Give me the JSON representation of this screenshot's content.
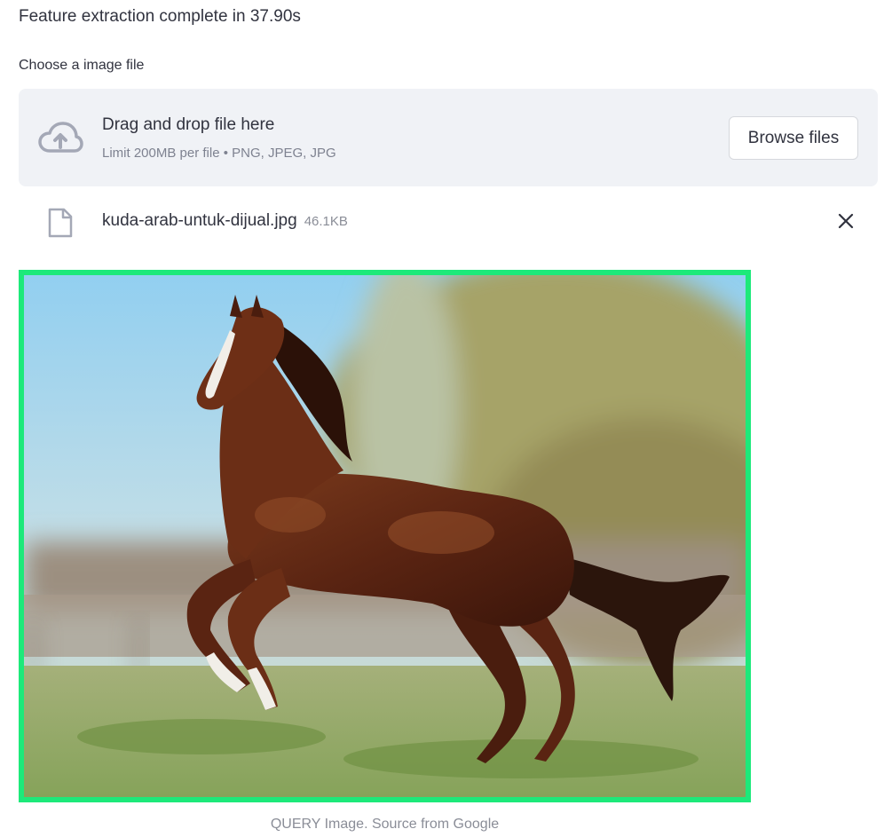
{
  "status": {
    "message": "Feature extraction complete in 37.90s"
  },
  "uploader": {
    "label": "Choose a image file",
    "dropzone_title": "Drag and drop file here",
    "dropzone_limit": "Limit 200MB per file • PNG, JPEG, JPG",
    "browse_label": "Browse files",
    "icon": "cloud-upload-icon"
  },
  "uploaded_file": {
    "name": "kuda-arab-untuk-dijual.jpg",
    "size": "46.1KB",
    "icon": "file-icon",
    "remove_icon": "close-icon"
  },
  "query_image": {
    "caption": "QUERY Image. Source from Google",
    "border_color": "#1de97a"
  }
}
